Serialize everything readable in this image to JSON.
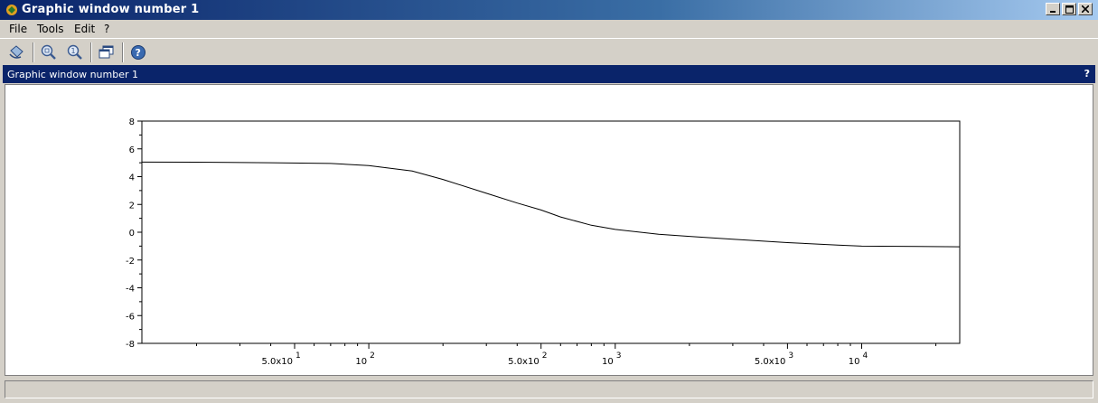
{
  "window": {
    "title": "Graphic window number 1"
  },
  "menu": {
    "file": "File",
    "tools": "Tools",
    "edit": "Edit",
    "help": "?"
  },
  "toolbar": {
    "buttons": [
      {
        "icon": "rotate-icon"
      },
      {
        "icon": "zoom-in-icon"
      },
      {
        "icon": "zoom-reset-icon"
      },
      {
        "icon": "windows-icon"
      },
      {
        "icon": "help-circle-icon"
      }
    ]
  },
  "panel": {
    "title": "Graphic window number 1",
    "help": "?"
  },
  "chart_data": {
    "type": "line",
    "xscale": "log",
    "xlim": [
      12,
      25000
    ],
    "ylim": [
      -8,
      8
    ],
    "grid": false,
    "title": "",
    "xlabel": "",
    "ylabel": "",
    "yticks": [
      "8",
      "6",
      "4",
      "2",
      "0",
      "-2",
      "-4",
      "-6",
      "-8"
    ],
    "xtick_labels": [
      {
        "value": 50,
        "base": "5.0x10",
        "exp": "1"
      },
      {
        "value": 100,
        "base": "10",
        "exp": "2"
      },
      {
        "value": 500,
        "base": "5.0x10",
        "exp": "2"
      },
      {
        "value": 1000,
        "base": "10",
        "exp": "3"
      },
      {
        "value": 5000,
        "base": "5.0x10",
        "exp": "3"
      },
      {
        "value": 10000,
        "base": "10",
        "exp": "4"
      }
    ],
    "x": [
      12,
      20,
      40,
      70,
      100,
      150,
      200,
      300,
      400,
      500,
      600,
      800,
      1000,
      1500,
      2000,
      3000,
      5000,
      8000,
      10000,
      25000
    ],
    "y": [
      5.05,
      5.04,
      5.0,
      4.95,
      4.8,
      4.4,
      3.8,
      2.8,
      2.1,
      1.6,
      1.1,
      0.5,
      0.2,
      -0.15,
      -0.3,
      -0.5,
      -0.75,
      -0.93,
      -1.0,
      -1.05
    ]
  }
}
